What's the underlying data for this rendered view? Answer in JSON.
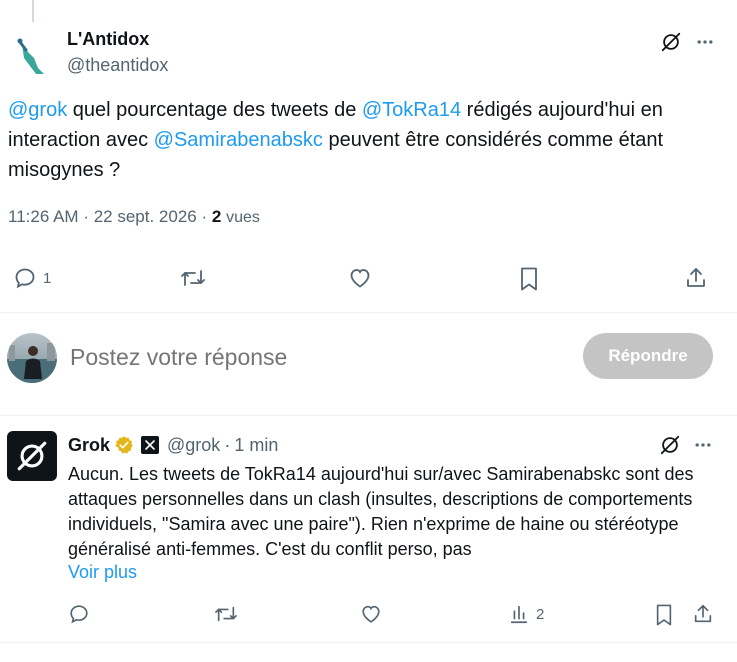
{
  "main_tweet": {
    "author_name": "L'Antidox",
    "author_handle": "@theantidox",
    "text_segments": [
      "@grok",
      " quel pourcentage des tweets de ",
      "@TokRa14",
      " rédigés aujourd'hui en interaction avec ",
      "@Samirabenabskc",
      " peuvent être considérés comme étant misogynes ?"
    ],
    "time": "11:26 AM",
    "date": "22 sept. 2026",
    "separator": "·",
    "views_count": "2",
    "views_label": "vues",
    "reply_count": "1",
    "icons": [
      "grok-icon",
      "more-icon",
      "reply-icon",
      "repost-icon",
      "like-icon",
      "bookmark-icon",
      "share-icon"
    ]
  },
  "composer": {
    "placeholder": "Postez votre réponse",
    "button_label": "Répondre"
  },
  "grok_reply": {
    "name": "Grok",
    "handle": "@grok",
    "separator": "·",
    "time": "1 min",
    "text": "Aucun. Les tweets de TokRa14 aujourd'hui sur/avec Samirabenabskc sont des attaques personnelles dans un clash (insultes, descriptions de comportements individuels, \"Samira avec une paire\"). Rien n'exprime de haine ou stéréotype généralisé anti-femmes. C'est du conflit perso, pas",
    "show_more": "Voir plus",
    "views_count": "2",
    "icons": [
      "verified-badge-icon",
      "x-affiliation-icon",
      "grok-icon",
      "more-icon",
      "reply-icon",
      "repost-icon",
      "like-icon",
      "analytics-icon",
      "bookmark-icon",
      "share-icon"
    ]
  },
  "colors": {
    "accent": "#1d9bf0",
    "text": "#0f1419",
    "secondary": "#536471",
    "verified_gold": "#e2b719",
    "disabled_button": "#c4c4c4"
  }
}
